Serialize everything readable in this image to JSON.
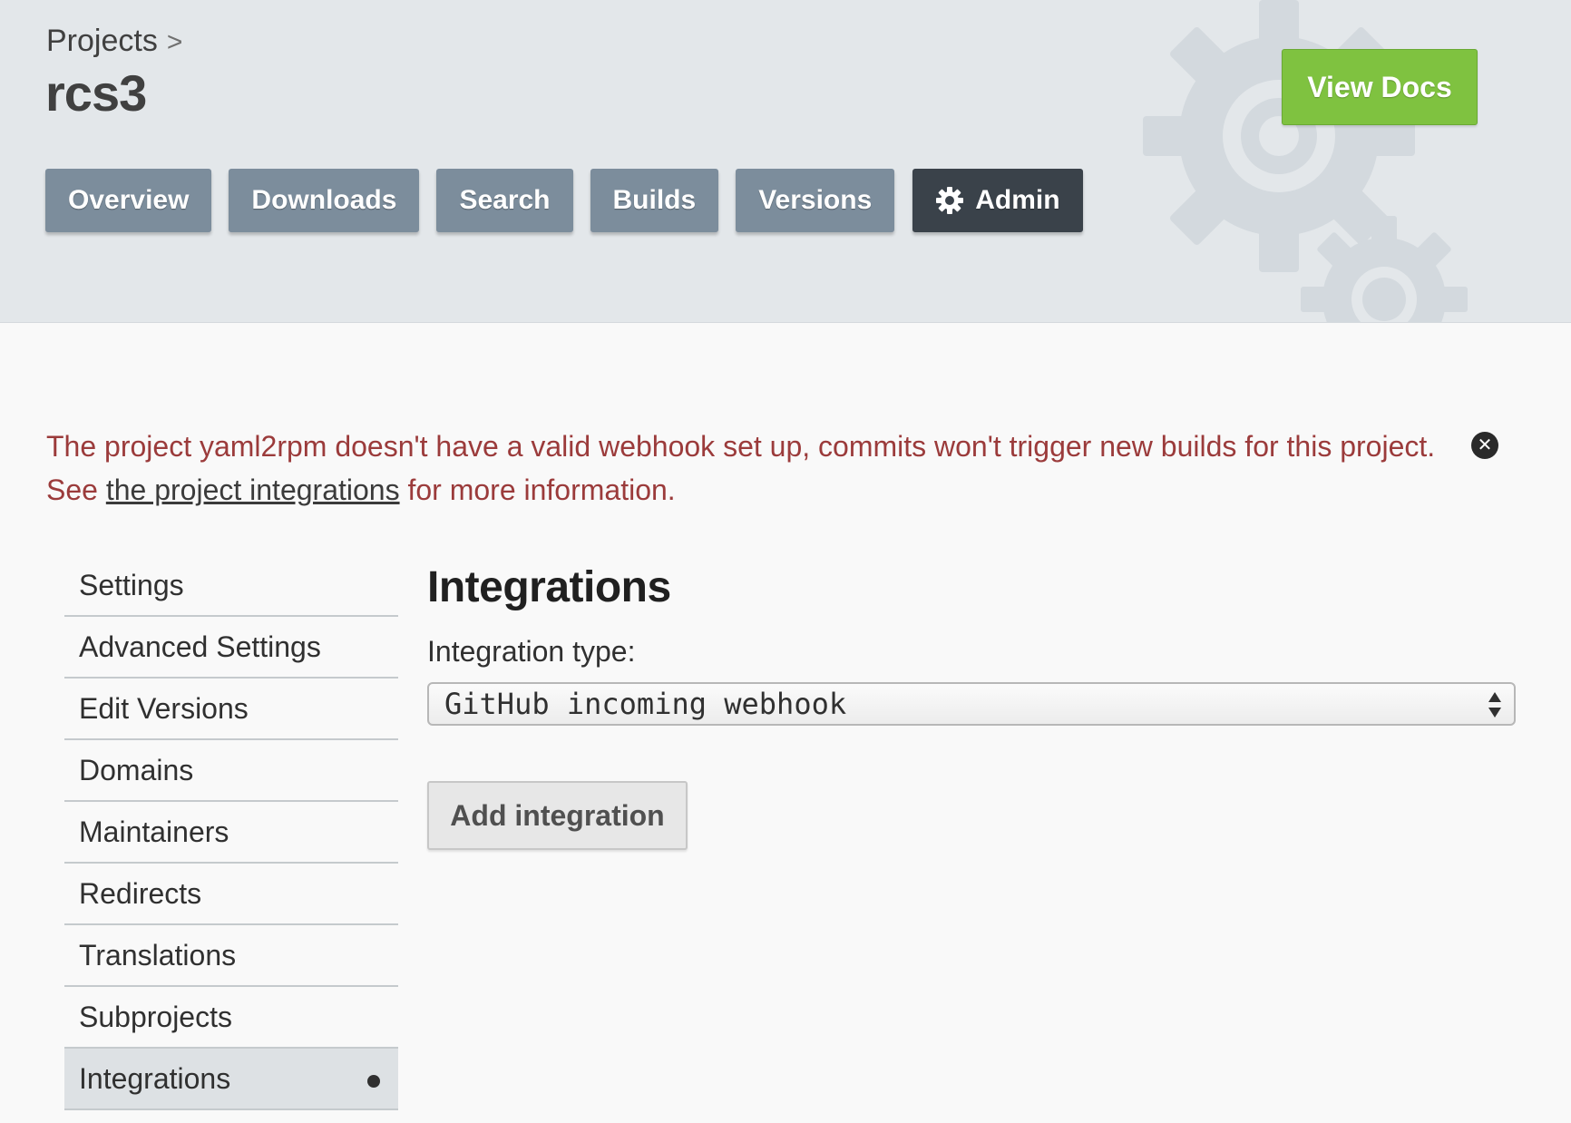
{
  "header": {
    "breadcrumb": {
      "parent": "Projects",
      "separator": ">"
    },
    "project_name": "rcs3",
    "view_docs_label": "View Docs",
    "tabs": [
      {
        "label": "Overview"
      },
      {
        "label": "Downloads"
      },
      {
        "label": "Search"
      },
      {
        "label": "Builds"
      },
      {
        "label": "Versions"
      },
      {
        "label": "Admin",
        "icon": "gear-icon",
        "active": true
      }
    ]
  },
  "alert": {
    "line1": "The project yaml2rpm doesn't have a valid webhook set up, commits won't trigger new builds for this project.",
    "see": "See ",
    "link_text": "the project integrations",
    "after": " for more information.",
    "close_glyph": "✕",
    "close_icon": "close-circle-icon"
  },
  "sidebar": {
    "items": [
      {
        "label": "Settings"
      },
      {
        "label": "Advanced Settings"
      },
      {
        "label": "Edit Versions"
      },
      {
        "label": "Domains"
      },
      {
        "label": "Maintainers"
      },
      {
        "label": "Redirects"
      },
      {
        "label": "Translations"
      },
      {
        "label": "Subprojects"
      },
      {
        "label": "Integrations",
        "active": true
      }
    ]
  },
  "main": {
    "title": "Integrations",
    "field_label": "Integration type:",
    "select_value": "GitHub incoming webhook",
    "add_button_label": "Add integration"
  },
  "colors": {
    "header_bg": "#e3e7ea",
    "tab_bg": "#7c8d9c",
    "tab_active_bg": "#3a424a",
    "view_docs_bg": "#7fc240",
    "alert_text": "#9b3b3b"
  }
}
